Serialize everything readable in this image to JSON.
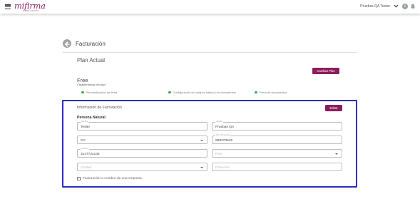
{
  "header": {
    "logo_text": "mifirma",
    "logo_tagline": "FIRMA DIGITAL",
    "user_name": "Pruebas QA Tester",
    "help_glyph": "i",
    "icons": {
      "menu": "hamburger-menu-icon",
      "user_menu": "chevron-down-icon",
      "help": "info-icon",
      "notifications": "bell-icon"
    }
  },
  "page": {
    "title": "Facturación",
    "back_icon": "arrow-left-circle-icon"
  },
  "plan": {
    "heading": "Plan Actual",
    "change_button": "Cambiar Plan",
    "name": "Free",
    "subtitle": "Características del plan",
    "features": [
      "Personalización de firma",
      "Configuración de campos básicos en documentos",
      "Firma de documentos"
    ],
    "feature_dot_color": "#3aa64a"
  },
  "billing": {
    "title": "Información de Facturación",
    "edit_button": "Editar",
    "persona_type": "Persona Natural",
    "fields": {
      "nombre": {
        "label": "Nombre",
        "value": "Tester"
      },
      "apellido": {
        "label": "Apellido",
        "value": "Pruebas QA"
      },
      "tipo_doc": {
        "label": "",
        "value": "CC"
      },
      "documento": {
        "label": "Nro. Documento",
        "value": "998273645"
      },
      "telefono": {
        "label": "Teléfono",
        "value": "3147724134"
      },
      "pais": {
        "label": "",
        "placeholder": "País"
      },
      "ciudad": {
        "label": "",
        "placeholder": "Ciudad"
      },
      "direccion": {
        "label": "",
        "placeholder": "Dirección"
      }
    },
    "company_checkbox_label": "Facturación a nombre de una empresa",
    "highlight_color": "#2d2dbf"
  },
  "colors": {
    "brand": "#8a1d5c",
    "logo": "#8e2a6c"
  }
}
